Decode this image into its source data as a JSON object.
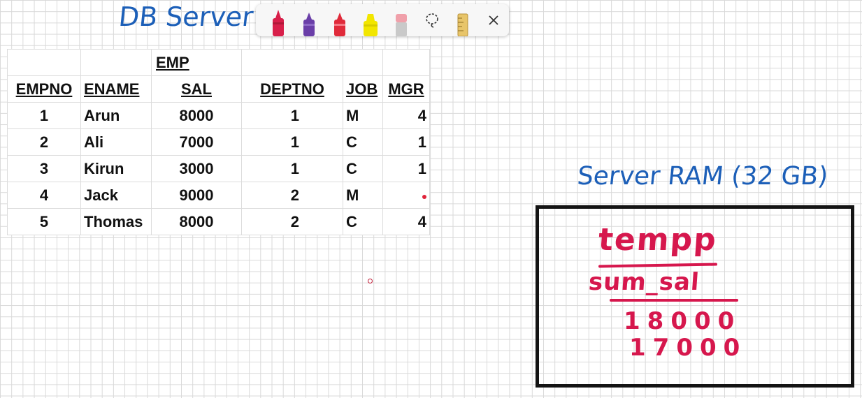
{
  "whiteboard": {
    "db_title": "DB Server",
    "ram_title": "Server RAM (32 GB)"
  },
  "toolbar": {
    "tools": [
      {
        "name": "red-pen-icon",
        "color": "#d81f4a"
      },
      {
        "name": "purple-pen-icon",
        "color": "#6a3ea8"
      },
      {
        "name": "red-marker-icon",
        "color": "#e02a3a"
      },
      {
        "name": "yellow-highlighter-icon",
        "color": "#f2e600"
      },
      {
        "name": "eraser-icon",
        "color": "#f0a0aa"
      },
      {
        "name": "lasso-icon"
      },
      {
        "name": "ruler-icon",
        "color": "#e8c56a"
      },
      {
        "name": "close-icon"
      }
    ]
  },
  "table": {
    "caption": "EMP",
    "headers": [
      "EMPNO",
      "ENAME",
      "SAL",
      "DEPTNO",
      "JOB",
      "MGR"
    ],
    "rows": [
      [
        "1",
        "Arun",
        "8000",
        "1",
        "M",
        "4"
      ],
      [
        "2",
        "Ali",
        "7000",
        "1",
        "C",
        "1"
      ],
      [
        "3",
        "Kirun",
        "3000",
        "1",
        "C",
        "1"
      ],
      [
        "4",
        "Jack",
        "9000",
        "2",
        "M",
        ""
      ],
      [
        "5",
        "Thomas",
        "8000",
        "2",
        "C",
        "4"
      ]
    ]
  },
  "ram": {
    "table_name": "tempp",
    "column_name": "sum_sal",
    "values": [
      "18000",
      "17000"
    ]
  },
  "colors": {
    "ink_blue": "#1c5fb8",
    "ink_red": "#d6174d"
  }
}
